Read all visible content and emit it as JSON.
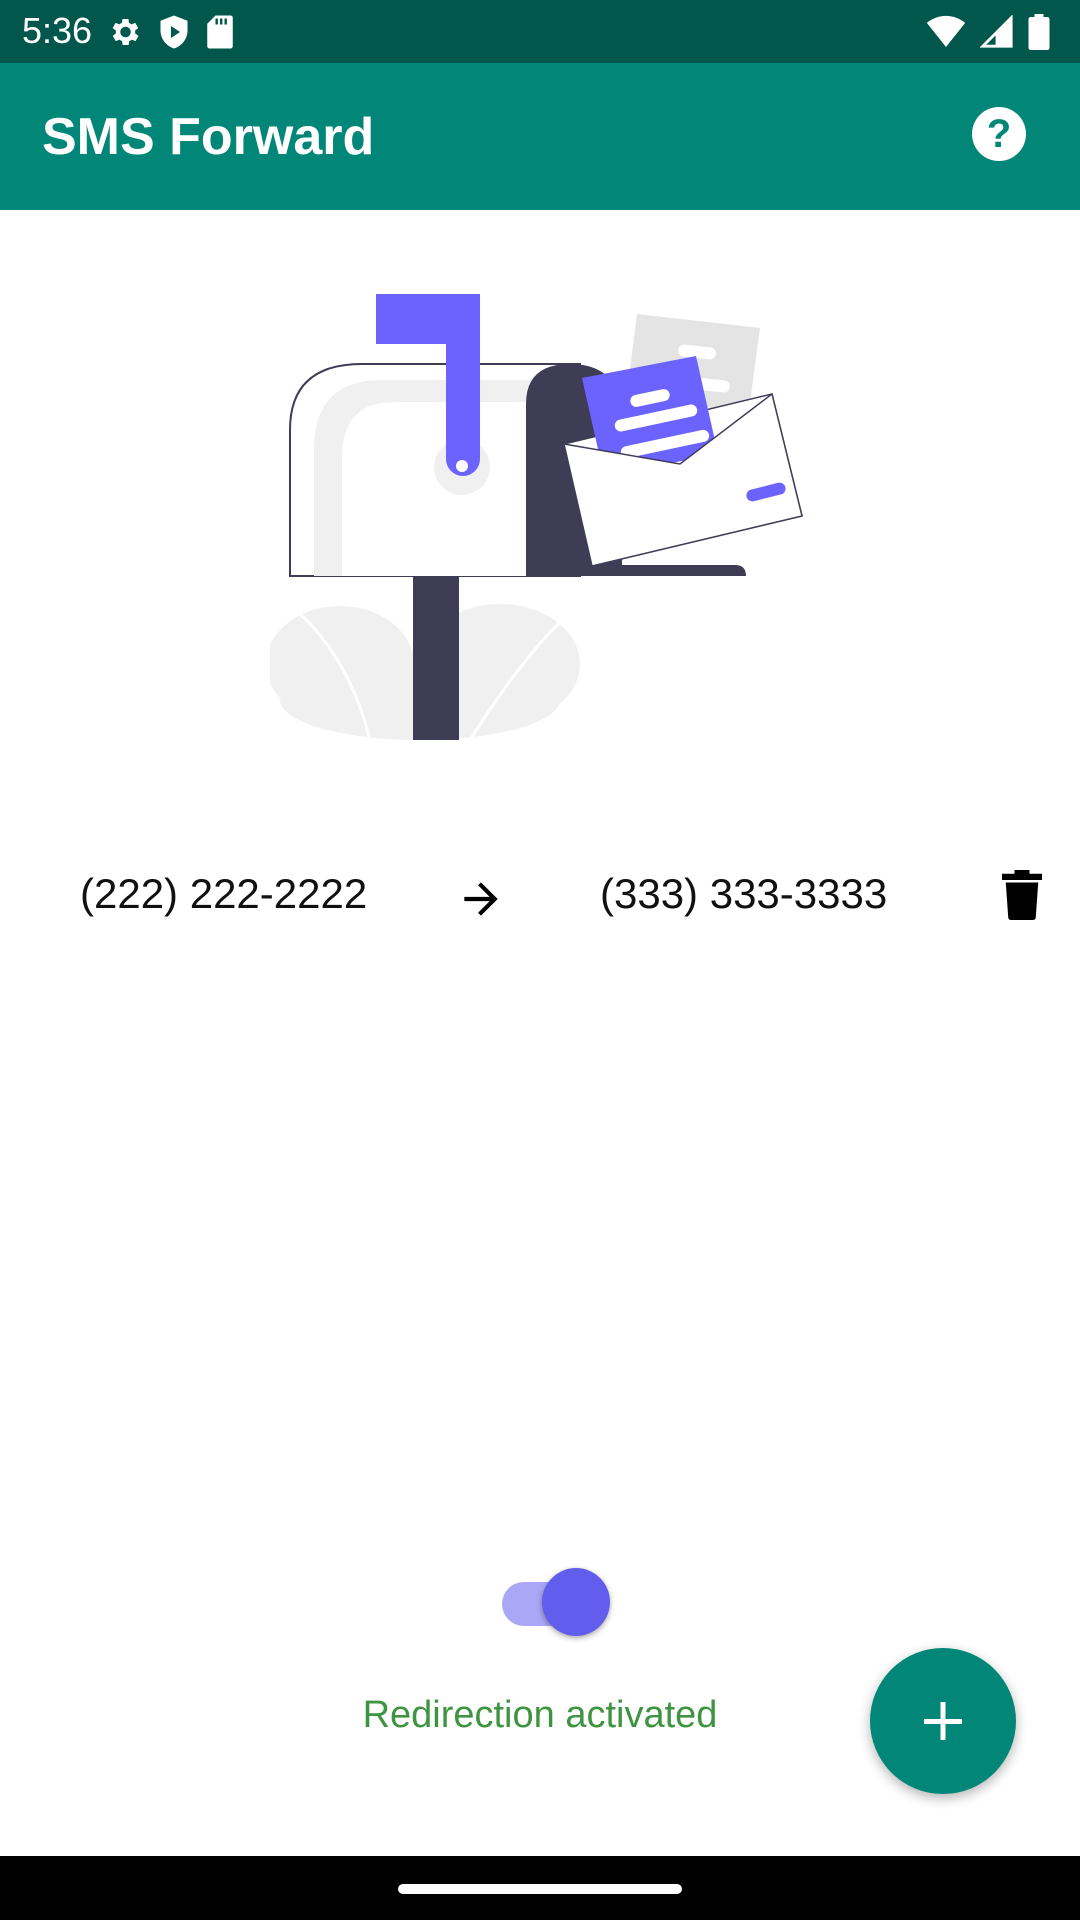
{
  "status_bar": {
    "time": "5:36",
    "left_icons": [
      "settings-icon",
      "shield-play-icon",
      "sd-card-icon"
    ],
    "right_icons": [
      "wifi-icon",
      "cell-signal-icon",
      "battery-icon"
    ]
  },
  "app_bar": {
    "title": "SMS Forward",
    "help_icon": "help-icon"
  },
  "illustration": {
    "name": "mailbox-illustration",
    "colors": {
      "accent": "#6c63ff",
      "dark": "#3f3d56",
      "light": "#f0f0f0"
    }
  },
  "rules": [
    {
      "from": "(222) 222-2222",
      "arrow_icon": "arrow-right-icon",
      "to": "(333) 333-3333",
      "delete_icon": "trash-icon"
    }
  ],
  "redirection": {
    "toggle_on": true,
    "status_text": "Redirection activated"
  },
  "fab": {
    "icon": "plus-icon"
  },
  "colors": {
    "status_bar": "#01574b",
    "app_bar": "#028677",
    "toggle_thumb": "#625dec",
    "toggle_track": "#aba7f7",
    "status_text": "#3e9441"
  }
}
